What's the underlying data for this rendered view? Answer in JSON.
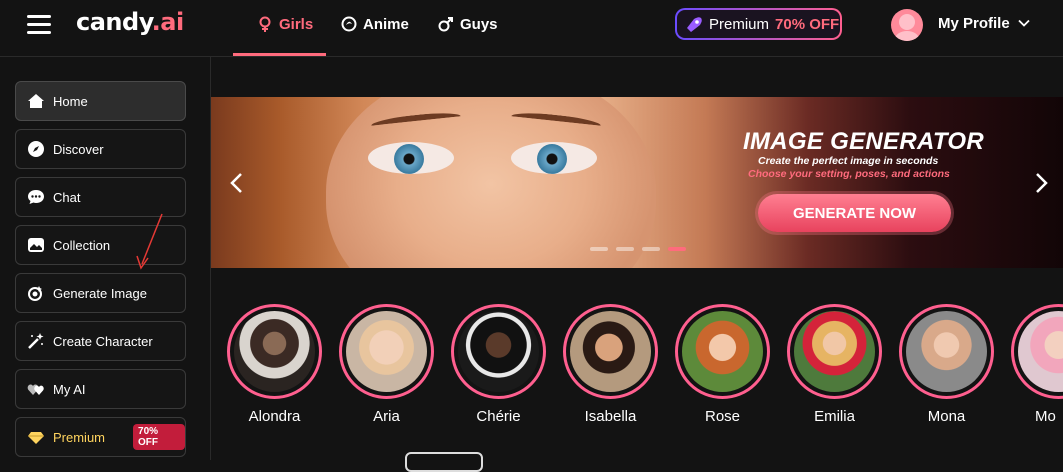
{
  "header": {
    "logo_main": "candy",
    "logo_ai": ".ai",
    "tabs": [
      {
        "label": "Girls"
      },
      {
        "label": "Anime"
      },
      {
        "label": "Guys"
      }
    ],
    "premium_label": "Premium",
    "premium_off": "70% OFF",
    "profile_label": "My Profile"
  },
  "sidebar": {
    "items": [
      {
        "label": "Home",
        "icon": "home-icon"
      },
      {
        "label": "Discover",
        "icon": "compass-icon"
      },
      {
        "label": "Chat",
        "icon": "chat-icon"
      },
      {
        "label": "Collection",
        "icon": "collection-icon"
      },
      {
        "label": "Generate Image",
        "icon": "generate-icon"
      },
      {
        "label": "Create Character",
        "icon": "magic-wand-icon"
      },
      {
        "label": "My AI",
        "icon": "hearts-icon"
      },
      {
        "label": "Premium",
        "icon": "diamond-icon",
        "badge": "70% OFF"
      }
    ]
  },
  "banner": {
    "title": "IMAGE GENERATOR",
    "subtitle": "Create the perfect image in seconds",
    "subtitle2": "Choose your setting, poses, and actions",
    "cta": "GENERATE NOW",
    "slide_count": 4,
    "active_slide": 4
  },
  "characters": [
    {
      "name": "Alondra"
    },
    {
      "name": "Aria"
    },
    {
      "name": "Chérie"
    },
    {
      "name": "Isabella"
    },
    {
      "name": "Rose"
    },
    {
      "name": "Emilia"
    },
    {
      "name": "Mona"
    },
    {
      "name": "Mo"
    }
  ],
  "colors": {
    "accent": "#ff6b7d",
    "background": "#131313",
    "premium": "#ffd45e"
  }
}
